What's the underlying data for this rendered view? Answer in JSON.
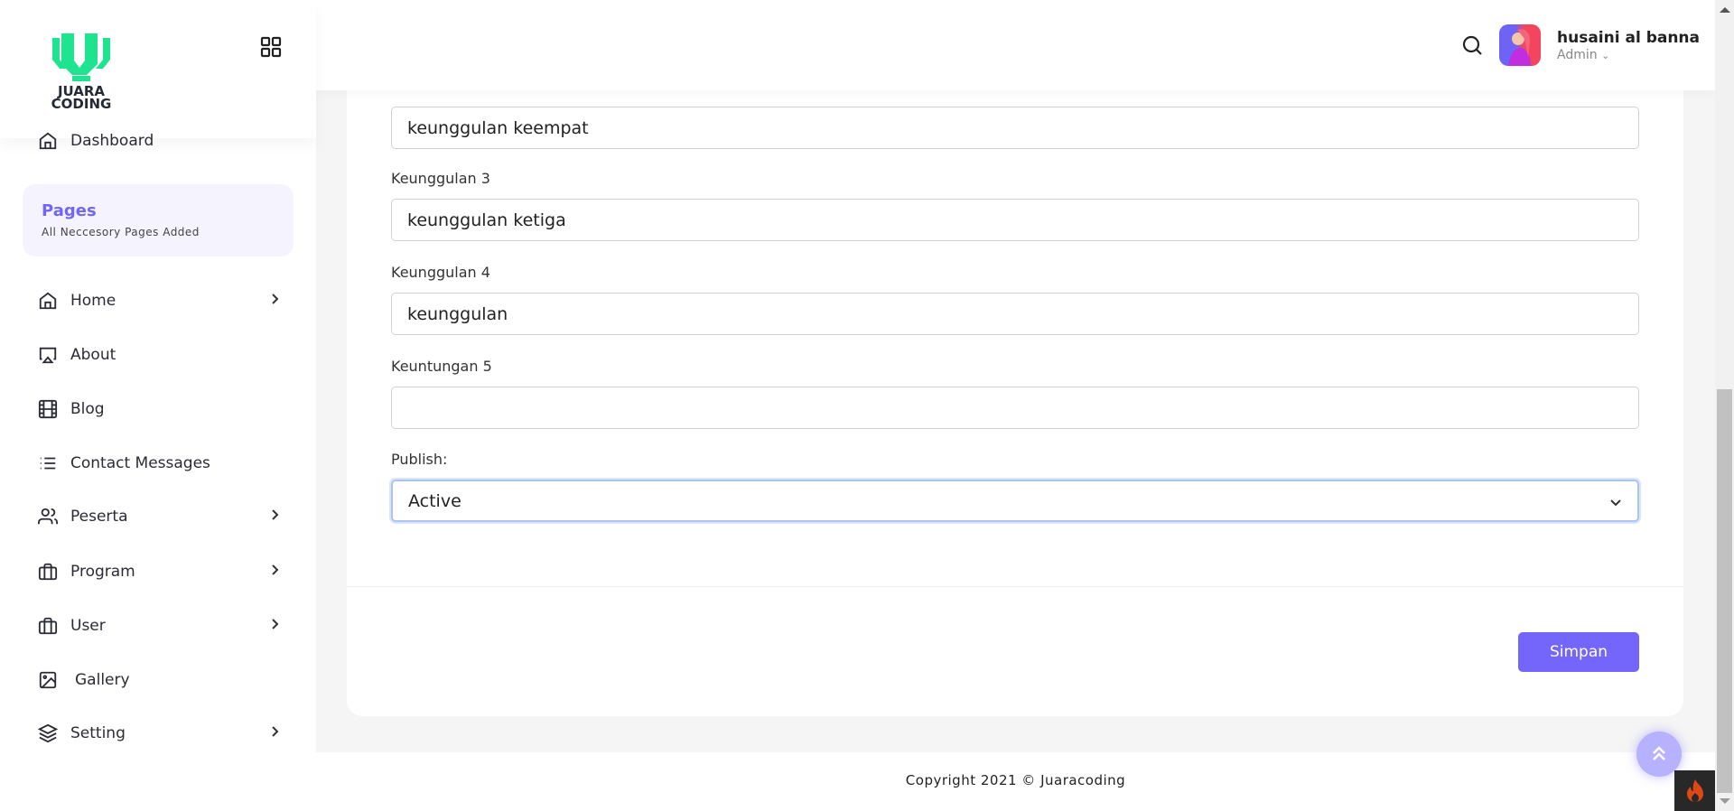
{
  "brand": {
    "logo_text_line1": "JUARA",
    "logo_text_line2": "CODING",
    "logo_color": "#1ee38f"
  },
  "sidebar": {
    "dashboard": "Dashboard",
    "section": {
      "title": "Pages",
      "subtitle": "All Neccesory Pages Added"
    },
    "items": [
      {
        "label": "Home",
        "icon": "home-icon",
        "chevron": true
      },
      {
        "label": "About",
        "icon": "airplay-icon",
        "chevron": false
      },
      {
        "label": "Blog",
        "icon": "film-icon",
        "chevron": false
      },
      {
        "label": "Contact Messages",
        "icon": "list-icon",
        "chevron": false
      },
      {
        "label": "Peserta",
        "icon": "users-icon",
        "chevron": true
      },
      {
        "label": "Program",
        "icon": "briefcase-icon",
        "chevron": true
      },
      {
        "label": "User",
        "icon": "briefcase-icon",
        "chevron": true
      },
      {
        "label": "Gallery",
        "icon": "image-icon",
        "chevron": false
      },
      {
        "label": "Setting",
        "icon": "layers-icon",
        "chevron": true
      }
    ]
  },
  "header": {
    "user_name": "husaini al banna",
    "user_role": "Admin"
  },
  "form": {
    "field_top_value": "keunggulan keempat",
    "fields": [
      {
        "label": "Keunggulan 3",
        "value": "keunggulan ketiga"
      },
      {
        "label": "Keunggulan 4",
        "value": "keunggulan"
      },
      {
        "label": "Keuntungan 5",
        "value": ""
      }
    ],
    "publish": {
      "label": "Publish:",
      "selected": "Active"
    },
    "submit_label": "Simpan"
  },
  "footer": {
    "copyright": "Copyright 2021 © Juaracoding"
  },
  "colors": {
    "accent": "#7466fb",
    "sidebar_section_bg": "#f5f4fe"
  }
}
